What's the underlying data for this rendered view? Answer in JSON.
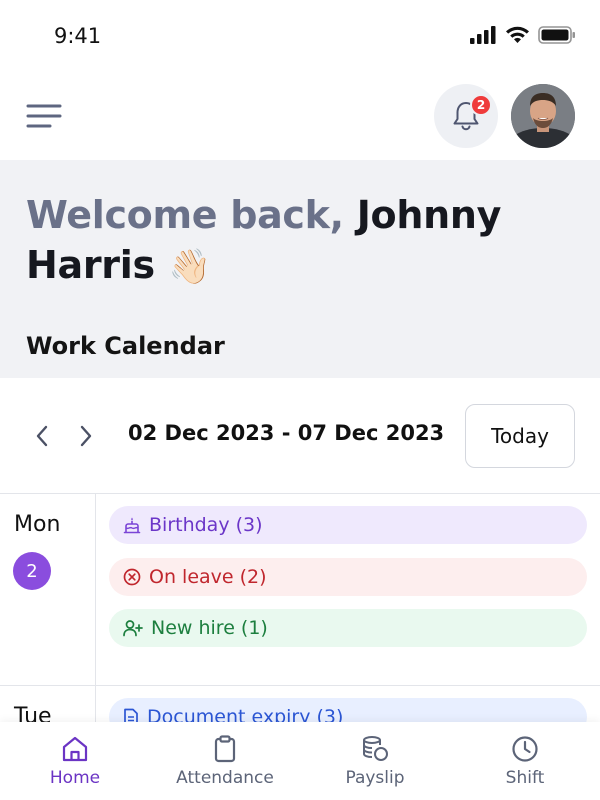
{
  "status_bar": {
    "time": "9:41"
  },
  "header": {
    "notification_count": "2"
  },
  "welcome": {
    "greeting": "Welcome back,",
    "user_name": "Johnny Harris",
    "emoji": "👋🏻"
  },
  "calendar": {
    "section_title": "Work Calendar",
    "date_range": "02 Dec 2023 - 07 Dec 2023",
    "today_label": "Today",
    "days": [
      {
        "label": "Mon",
        "number": "2",
        "events": [
          {
            "label": "Birthday (3)",
            "icon": "cake-icon"
          },
          {
            "label": "On leave (2)",
            "icon": "x-circle-icon"
          },
          {
            "label": "New hire (1)",
            "icon": "user-plus-icon"
          }
        ]
      },
      {
        "label": "Tue",
        "events": [
          {
            "label": "Document expiry (3)",
            "icon": "document-icon"
          }
        ]
      }
    ]
  },
  "bottom_nav": {
    "items": [
      {
        "label": "Home",
        "icon": "home-icon",
        "active": true
      },
      {
        "label": "Attendance",
        "icon": "clipboard-icon",
        "active": false
      },
      {
        "label": "Payslip",
        "icon": "coins-icon",
        "active": false
      },
      {
        "label": "Shift",
        "icon": "clock-icon",
        "active": false
      }
    ]
  },
  "colors": {
    "accent": "#6b34c4",
    "badge": "#ef3b3b",
    "welcome_bg": "#f1f2f5"
  }
}
